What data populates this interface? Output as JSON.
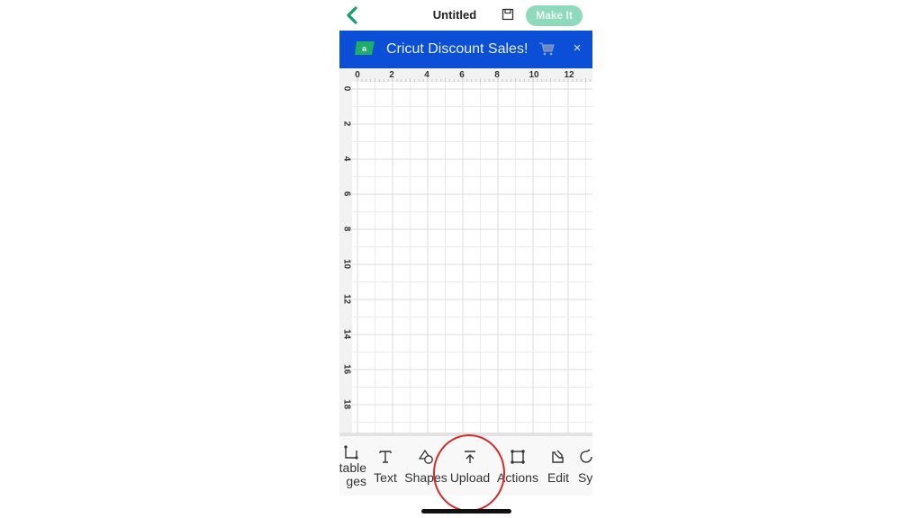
{
  "header": {
    "back_icon": "chevron-left-icon",
    "title": "Untitled",
    "save_icon": "save-icon",
    "make_it_label": "Make It"
  },
  "banner": {
    "logo_icon": "cricut-logo-icon",
    "text": "Cricut Discount Sales!",
    "cart_icon": "shopping-cart-icon",
    "close_label": "×",
    "background_color": "#0b4fd6"
  },
  "canvas": {
    "ruler_top_labels": [
      "0",
      "2",
      "4",
      "6",
      "8",
      "10",
      "12"
    ],
    "ruler_left_labels": [
      "0",
      "2",
      "4",
      "6",
      "8",
      "10",
      "12",
      "14",
      "16",
      "18"
    ]
  },
  "toolbar": {
    "items": [
      {
        "label_line1": "table",
        "label_line2": "ges",
        "icon": "editable-images-icon"
      },
      {
        "label": "Text",
        "icon": "text-icon"
      },
      {
        "label": "Shapes",
        "icon": "shapes-icon"
      },
      {
        "label": "Upload",
        "icon": "upload-icon"
      },
      {
        "label": "Actions",
        "icon": "actions-icon"
      },
      {
        "label": "Edit",
        "icon": "edit-icon"
      },
      {
        "label": "Sy",
        "icon": "sync-icon"
      }
    ]
  },
  "annotation": {
    "highlight_color": "#d42a2a",
    "highlighted_item": "Upload"
  },
  "colors": {
    "accent_green": "#12a06a",
    "make_it_disabled": "#8fd9bc"
  }
}
